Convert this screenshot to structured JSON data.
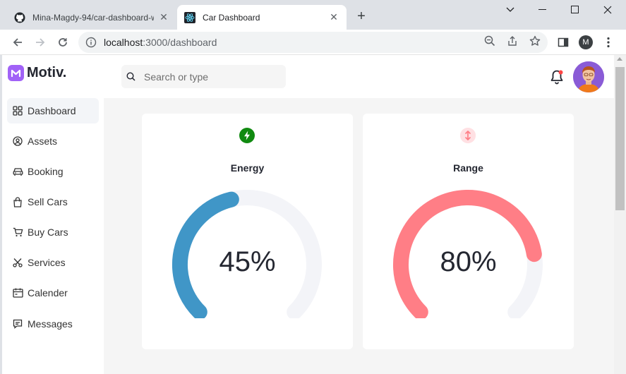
{
  "browser": {
    "tabs": [
      {
        "title": "Mina-Magdy-94/car-dashboard-w",
        "active": false,
        "favicon": "github-icon"
      },
      {
        "title": "Car Dashboard",
        "active": true,
        "favicon": "react-icon"
      }
    ],
    "url_host": "localhost",
    "url_path": ":3000/dashboard",
    "profile_initial": "M"
  },
  "app": {
    "logo_text": "Motiv.",
    "search_placeholder": "Search or type",
    "brand_color": "#a162f7"
  },
  "sidebar": {
    "items": [
      {
        "label": "Dashboard",
        "icon": "grid-icon",
        "active": true
      },
      {
        "label": "Assets",
        "icon": "user-circle-icon"
      },
      {
        "label": "Booking",
        "icon": "car-icon"
      },
      {
        "label": "Sell Cars",
        "icon": "shopping-bag-icon"
      },
      {
        "label": "Buy Cars",
        "icon": "cart-icon"
      },
      {
        "label": "Services",
        "icon": "scissors-icon"
      },
      {
        "label": "Calender",
        "icon": "calendar-icon"
      },
      {
        "label": "Messages",
        "icon": "message-icon"
      }
    ]
  },
  "cards": [
    {
      "title": "Energy",
      "value_text": "45%",
      "value": 0.45,
      "color": "#4096c7",
      "icon": "lightning-icon",
      "icon_bg": "#108a10"
    },
    {
      "title": "Range",
      "value_text": "80%",
      "value": 0.8,
      "color": "#ff7e86",
      "icon": "vertical-arrows-icon",
      "icon_bg": "#ffe0e3"
    }
  ]
}
